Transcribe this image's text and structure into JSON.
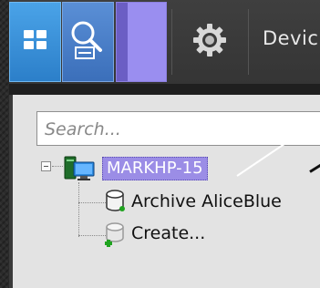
{
  "toolbar": {
    "home_icon": "grid-icon",
    "search_icon": "search-magnifier-icon",
    "settings_icon": "gear-icon",
    "devices_label": "Devic"
  },
  "sidebar": {
    "search_placeholder": "Search...",
    "tree": {
      "root": {
        "label": "MARKHP-15",
        "icon": "computer-server-icon"
      },
      "children": [
        {
          "label": "Archive AliceBlue",
          "icon": "database-icon"
        },
        {
          "label": "Create...",
          "icon": "database-add-icon"
        }
      ]
    }
  },
  "colors": {
    "accent_blue": "#2c7fc9",
    "selected_node": "#9b8de6",
    "toolbar_bg": "#3a3a3a",
    "add_green": "#1fa31f"
  }
}
